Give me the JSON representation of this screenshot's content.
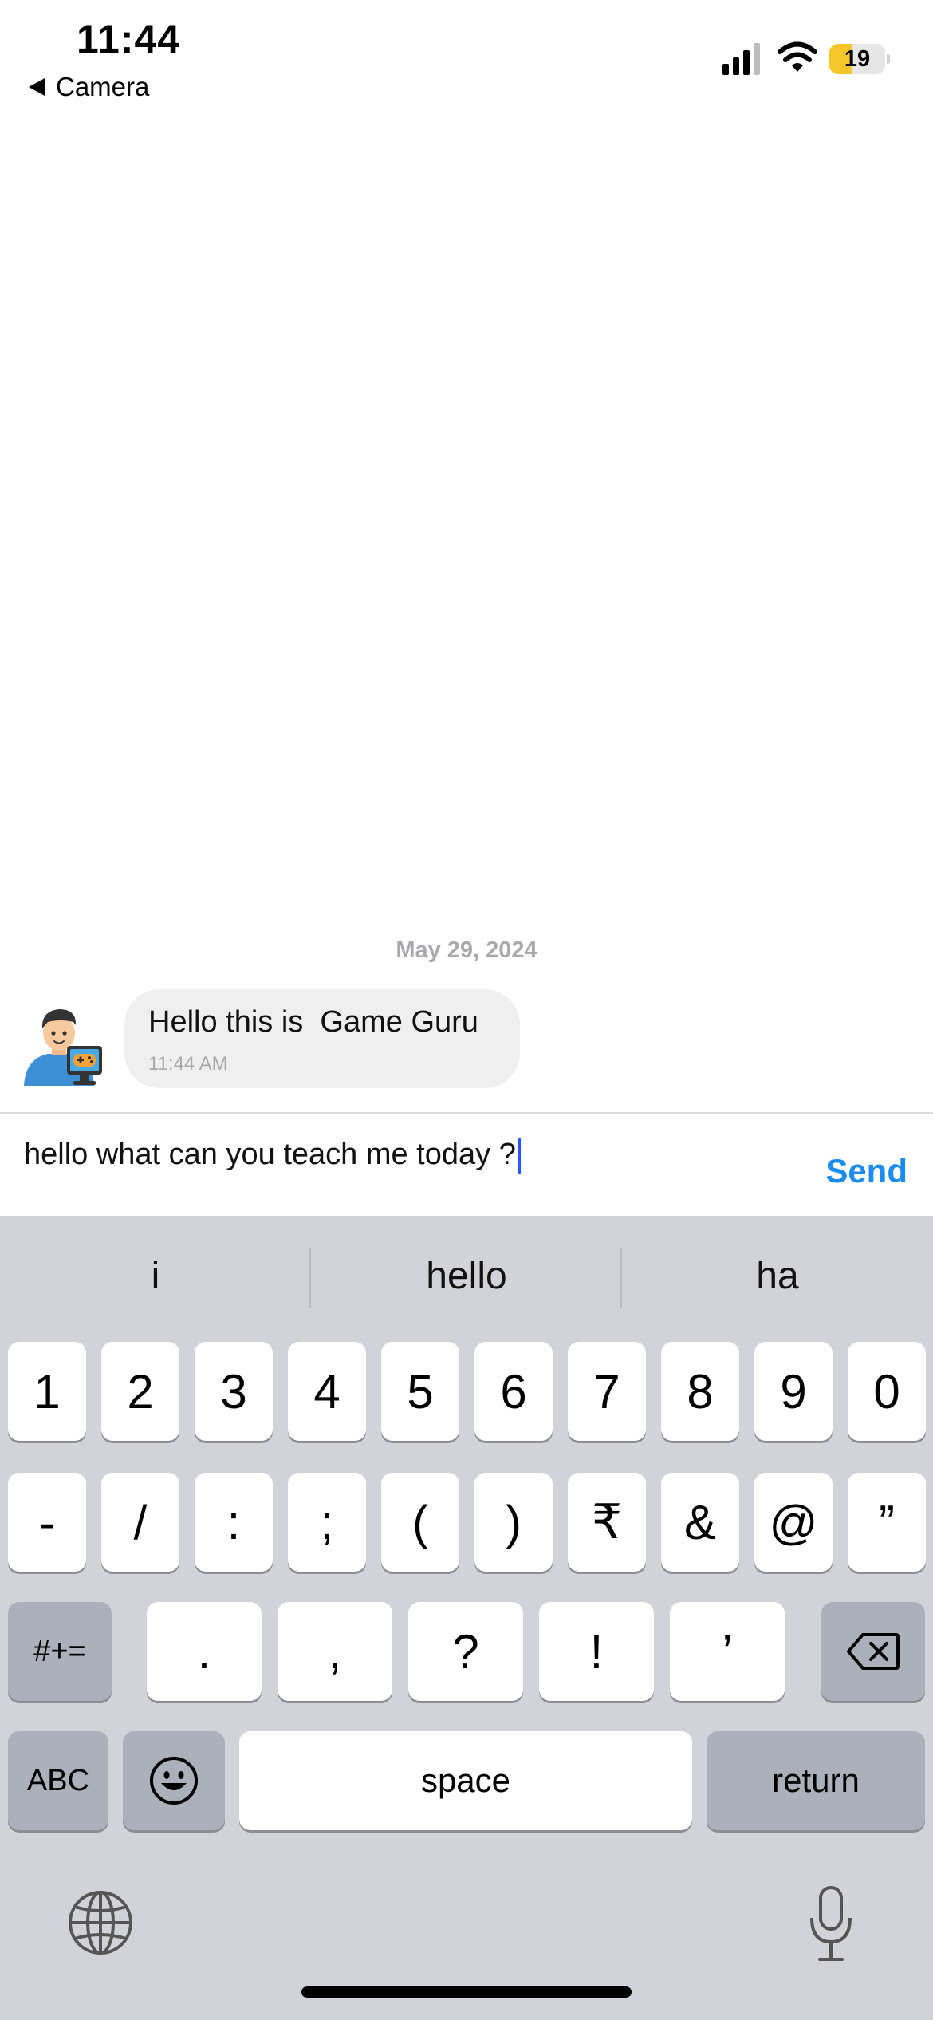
{
  "status_bar": {
    "time": "11:44",
    "back_label": "Camera",
    "battery_level": "19",
    "battery_fraction": 0.19
  },
  "chat": {
    "date": "May 29, 2024",
    "messages": [
      {
        "text": "Hello this is  Game Guru",
        "time": "11:44 AM"
      }
    ]
  },
  "input": {
    "value": "hello what can you teach me today ?",
    "send_label": "Send"
  },
  "keyboard": {
    "suggestions": [
      "i",
      "hello",
      "ha"
    ],
    "row1": [
      "1",
      "2",
      "3",
      "4",
      "5",
      "6",
      "7",
      "8",
      "9",
      "0"
    ],
    "row2": [
      "-",
      "/",
      ":",
      ";",
      "(",
      ")",
      "₹",
      "&",
      "@",
      "”"
    ],
    "row3_left": "#+=",
    "row3": [
      ".",
      ",",
      "?",
      "!",
      "’"
    ],
    "abc_label": "ABC",
    "space_label": "space",
    "return_label": "return"
  },
  "icons": {
    "back": "back-arrow-icon",
    "signal": "signal-icon",
    "wifi": "wifi-icon",
    "battery": "battery-icon",
    "avatar": "game-guru-avatar",
    "backspace": "backspace-icon",
    "emoji": "emoji-icon",
    "globe": "globe-icon",
    "mic": "microphone-icon"
  },
  "colors": {
    "accent": "#1a8cf2",
    "caret": "#2b57ff",
    "battery": "#f5c62a",
    "keyboard_bg": "#d1d3d9"
  }
}
